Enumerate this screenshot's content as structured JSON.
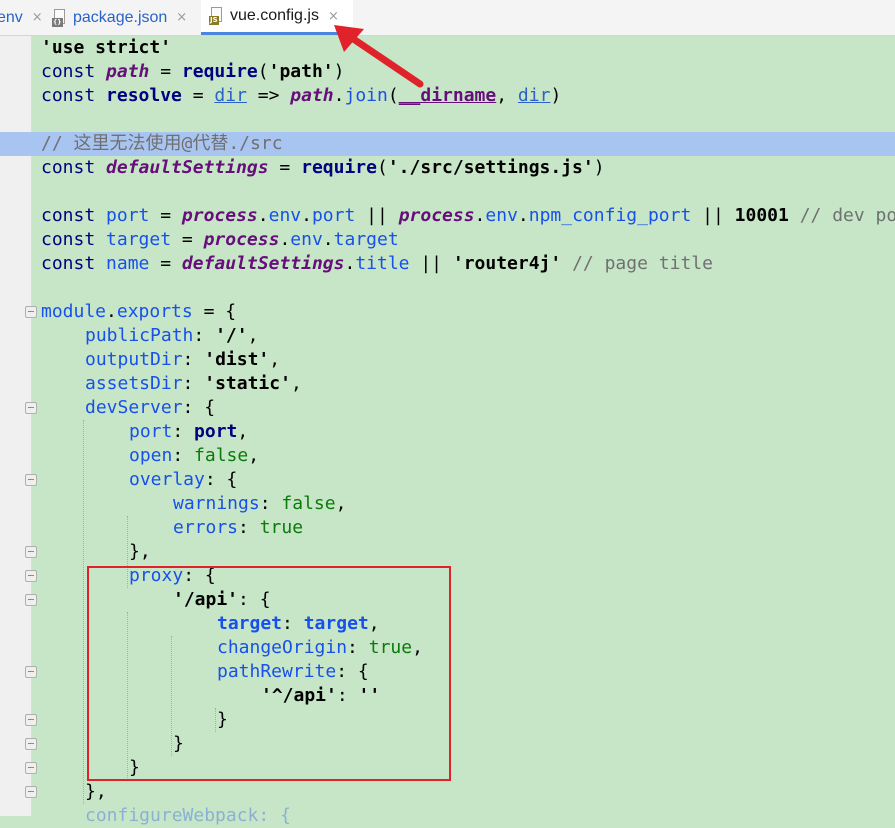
{
  "tabs": [
    {
      "label": "env",
      "close": "×"
    },
    {
      "label": "package.json",
      "icon": "json-file-icon",
      "close": "×"
    },
    {
      "label": "vue.config.js",
      "icon": "js-file-icon",
      "close": "×",
      "active": true
    }
  ],
  "code": {
    "l1": "'use strict'",
    "l2a": "const ",
    "l2b": "path",
    "l2c": " = ",
    "l2d": "require",
    "l2e": "(",
    "l2f": "'path'",
    "l2g": ")",
    "l3a": "const ",
    "l3b": "resolve",
    "l3c": " = ",
    "l3d": "dir",
    "l3e": " => ",
    "l3f": "path",
    "l3g": ".",
    "l3h": "join",
    "l3i": "(",
    "l3j": "__dirname",
    "l3k": ", ",
    "l3l": "dir",
    "l3m": ")",
    "l5": "// 这里无法使用@代替./src",
    "l6a": "const ",
    "l6b": "defaultSettings",
    "l6c": " = ",
    "l6d": "require",
    "l6e": "(",
    "l6f": "'./src/settings.js'",
    "l6g": ")",
    "l8a": "const ",
    "l8b": "port",
    "l8c": " = ",
    "l8d": "process",
    "l8e": ".",
    "l8f": "env",
    "l8g": ".",
    "l8h": "port",
    "l8i": " || ",
    "l8j": "process",
    "l8k": ".",
    "l8l": "env",
    "l8m": ".",
    "l8n": "npm_config_port",
    "l8o": " || ",
    "l8p": "10001",
    "l8q": " // dev port",
    "l9a": "const ",
    "l9b": "target",
    "l9c": " = ",
    "l9d": "process",
    "l9e": ".",
    "l9f": "env",
    "l9g": ".",
    "l9h": "target",
    "l10a": "const ",
    "l10b": "name",
    "l10c": " = ",
    "l10d": "defaultSettings",
    "l10e": ".",
    "l10f": "title",
    "l10g": " || ",
    "l10h": "'router4j'",
    "l10i": " // page title",
    "l12a": "module",
    "l12b": ".",
    "l12c": "exports",
    "l12d": " = {",
    "l13a": "publicPath",
    "l13b": ": ",
    "l13c": "'/'",
    "l13d": ",",
    "l14a": "outputDir",
    "l14b": ": ",
    "l14c": "'dist'",
    "l14d": ",",
    "l15a": "assetsDir",
    "l15b": ": ",
    "l15c": "'static'",
    "l15d": ",",
    "l16a": "devServer",
    "l16b": ": {",
    "l17a": "port",
    "l17b": ": ",
    "l17c": "port",
    "l17d": ",",
    "l18a": "open",
    "l18b": ": ",
    "l18c": "false",
    "l18d": ",",
    "l19a": "overlay",
    "l19b": ": {",
    "l20a": "warnings",
    "l20b": ": ",
    "l20c": "false",
    "l20d": ",",
    "l21a": "errors",
    "l21b": ": ",
    "l21c": "true",
    "l22": "},",
    "l23a": "proxy",
    "l23b": ": {",
    "l24a": "'/api'",
    "l24b": ": {",
    "l25a": "target",
    "l25b": ": ",
    "l25c": "target",
    "l25d": ",",
    "l26a": "changeOrigin",
    "l26b": ": ",
    "l26c": "true",
    "l26d": ",",
    "l27a": "pathRewrite",
    "l27b": ": {",
    "l28a": "'^/api'",
    "l28b": ": ",
    "l28c": "''",
    "l29": "}",
    "l30": "}",
    "l31": "}",
    "l32": "},",
    "l33": "configureWebpack: {"
  }
}
